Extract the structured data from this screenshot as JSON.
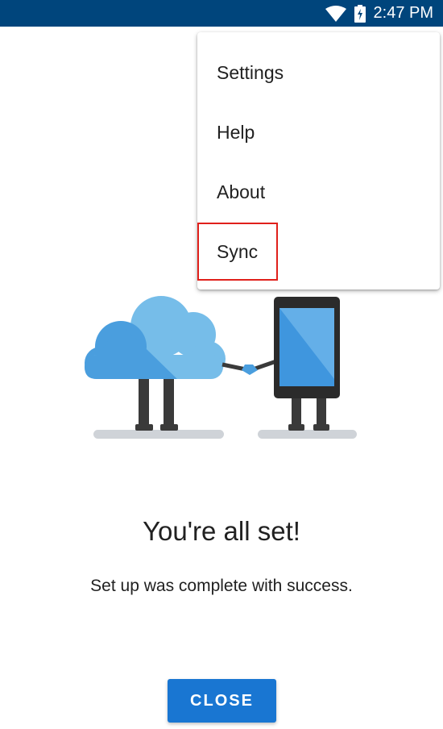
{
  "status_bar": {
    "time": "2:47 PM",
    "icons": [
      "wifi-icon",
      "battery-charging-icon"
    ],
    "background": "#00457c"
  },
  "overflow_menu": {
    "items": [
      {
        "label": "Settings"
      },
      {
        "label": "Help"
      },
      {
        "label": "About"
      },
      {
        "label": "Sync",
        "highlighted": true
      }
    ],
    "highlight_color": "#e0201b"
  },
  "illustration": {
    "icon": "cloud-shaking-hands-with-phone-illustration"
  },
  "main": {
    "title": "You're all set!",
    "message": "Set up was complete with success.",
    "close_label": "CLOSE",
    "accent": "#1976d2"
  }
}
